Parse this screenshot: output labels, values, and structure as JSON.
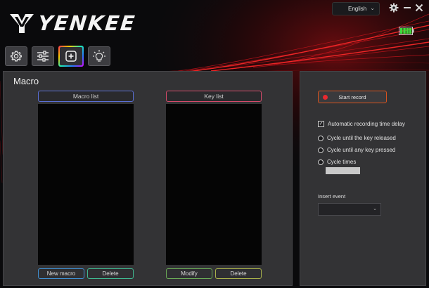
{
  "app": {
    "brand": "YENKEE"
  },
  "header": {
    "language": "English",
    "icons": [
      "gear-icon",
      "minimize-icon",
      "close-icon"
    ],
    "battery": "battery-full-icon"
  },
  "tabs": [
    {
      "name": "settings",
      "icon": "gear-icon"
    },
    {
      "name": "adjust",
      "icon": "sliders-icon"
    },
    {
      "name": "macro",
      "icon": "plus-square-icon",
      "active": true
    },
    {
      "name": "lighting",
      "icon": "lightbulb-icon"
    }
  ],
  "macro": {
    "title": "Macro",
    "macro_list_label": "Macro list",
    "key_list_label": "Key list",
    "new_macro": "New macro",
    "delete": "Delete",
    "modify": "Modify",
    "delete_keys": "Delete"
  },
  "recording": {
    "start_record": "Start record",
    "auto_delay": "Automatic recording time delay",
    "auto_delay_checked": true,
    "cycle_until_released": "Cycle until the key released",
    "cycle_until_pressed": "Cycle until any key pressed",
    "cycle_times": "Cycle times",
    "cycle_times_value": "",
    "insert_event_label": "Insert event",
    "insert_event_value": ""
  },
  "colors": {
    "accent_red": "#e8292f",
    "record_border": "#d9531e",
    "battery_green": "#3ddc3d",
    "macro_list_border": "#5a6fd6",
    "key_list_border": "#d64a6a"
  }
}
